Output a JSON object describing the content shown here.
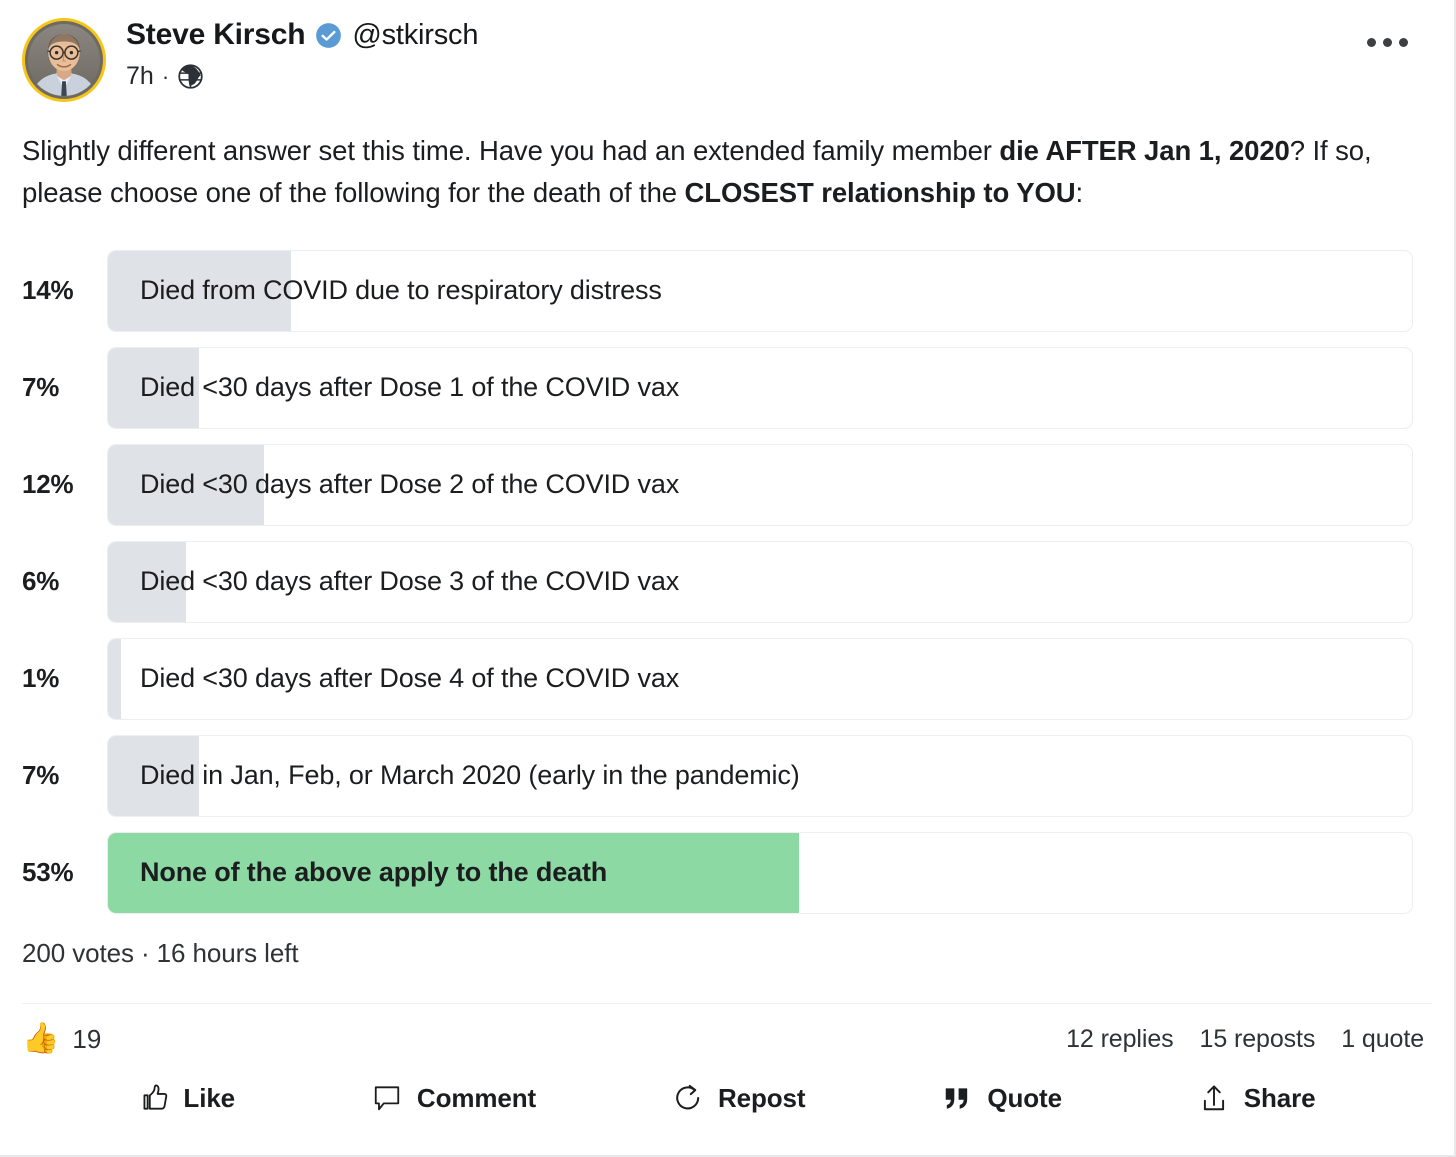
{
  "author": {
    "display_name": "Steve Kirsch",
    "handle": "@stkirsch",
    "verified_icon": "verified-check-icon",
    "timestamp": "7h",
    "separator": "·",
    "audience_icon": "globe-icon",
    "avatar_icon": "user-avatar-photo",
    "avatar_ring_color": "#f5c518"
  },
  "header": {
    "more_icon": "more-options-icon"
  },
  "post": {
    "text_part_1": "Slightly different answer set this time. Have you had an extended family member ",
    "text_bold_1": "die AFTER Jan 1, 2020",
    "text_part_2": "? If so, please choose one of the following for the death of the ",
    "text_bold_2": "CLOSEST relationship to YOU",
    "text_part_3": ":"
  },
  "poll": {
    "options": [
      {
        "percent_label": "14%",
        "percent": 14,
        "text": "Died from COVID due to respiratory distress",
        "chosen": false
      },
      {
        "percent_label": "7%",
        "percent": 7,
        "text": "Died <30 days after Dose 1 of the COVID vax",
        "chosen": false
      },
      {
        "percent_label": "12%",
        "percent": 12,
        "text": "Died <30 days after Dose 2 of the COVID vax",
        "chosen": false
      },
      {
        "percent_label": "6%",
        "percent": 6,
        "text": "Died <30 days after Dose 3 of the COVID vax",
        "chosen": false
      },
      {
        "percent_label": "1%",
        "percent": 1,
        "text": "Died <30 days after Dose 4 of the COVID vax",
        "chosen": false
      },
      {
        "percent_label": "7%",
        "percent": 7,
        "text": "Died in Jan, Feb, or March 2020 (early in the pandemic)",
        "chosen": false
      },
      {
        "percent_label": "53%",
        "percent": 53,
        "text": "None of the above apply to the death",
        "chosen": true
      }
    ],
    "meta": "200 votes · 16 hours left",
    "fill_color": "#dfe3e8",
    "chosen_fill_color": "#8cd9a3"
  },
  "reactions": {
    "thumb_icon": "thumbs-up-emoji",
    "thumb_glyph": "👍",
    "count": "19",
    "replies": "12 replies",
    "reposts": "15 reposts",
    "quotes": "1 quote"
  },
  "actions": [
    {
      "label": "Like",
      "icon": "thumbs-up-icon"
    },
    {
      "label": "Comment",
      "icon": "comment-bubble-icon"
    },
    {
      "label": "Repost",
      "icon": "repost-arrow-icon"
    },
    {
      "label": "Quote",
      "icon": "quotation-marks-icon"
    },
    {
      "label": "Share",
      "icon": "share-upload-icon"
    }
  ]
}
